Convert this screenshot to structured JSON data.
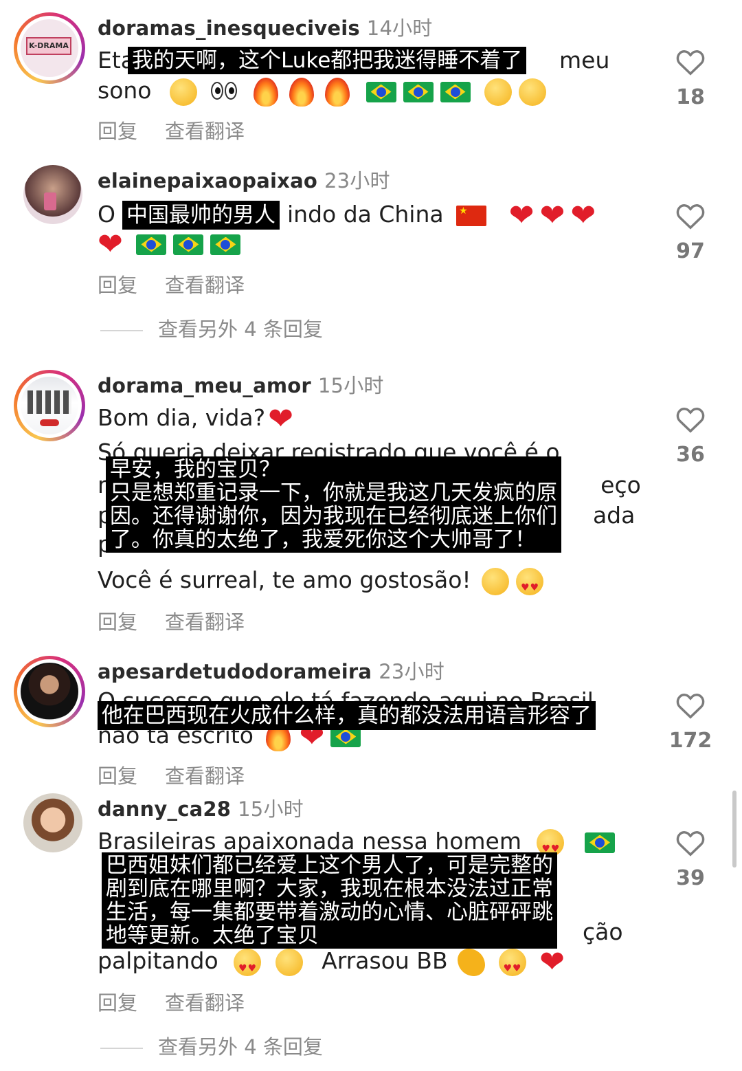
{
  "comments": [
    {
      "username": "doramas_inesqueciveis",
      "time": "14小时",
      "line1_prefix": "Eta",
      "line1_suffix": "meu",
      "line2": "sono",
      "overlay": "我的天啊，这个Luke都把我迷得睡不着了",
      "likes": "18",
      "reply": "回复",
      "translate": "查看翻译",
      "avatar_text": "K-DRAMA"
    },
    {
      "username": "elainepaixaopaixao",
      "time": "23小时",
      "line1_prefix": "O",
      "line1_suffix": "indo da China",
      "overlay": "中国最帅的男人",
      "likes": "97",
      "reply": "回复",
      "translate": "查看翻译",
      "more_replies": "查看另外 4 条回复"
    },
    {
      "username": "dorama_meu_amor",
      "time": "15小时",
      "line1": "Bom dia, vida?",
      "line2_fragment": "Só queria deixar registrado que você é o",
      "line3_left": "m",
      "line3_right": "eço",
      "line4_left": "p",
      "line4_right": "ada",
      "line5_left": "p",
      "overlay_lines": [
        "早安，我的宝贝？",
        "只是想郑重记录一下，你就是我这几天发疯的原",
        "因。还得谢谢你，因为我现在已经彻底迷上你们",
        "了。你真的太绝了，我爱死你这个大帅哥了！"
      ],
      "line_last": "Você é surreal, te amo gostosão!",
      "likes": "36",
      "reply": "回复",
      "translate": "查看翻译"
    },
    {
      "username": "apesardetudodorameira",
      "time": "23小时",
      "line1_fragment": "O sucesso que ele tá fazendo aqui no Brasil",
      "line2": "não tá escrito",
      "overlay": "他在巴西现在火成什么样，真的都没法用语言形容了",
      "likes": "172",
      "reply": "回复",
      "translate": "查看翻译"
    },
    {
      "username": "danny_ca28",
      "time": "15小时",
      "line1": "Brasileiras apaixonada nessa homem",
      "line_tail": "ção",
      "line_last_text": "palpitando",
      "line_last_mid": "Arrasou BB",
      "overlay_lines": [
        "巴西姐妹们都已经爱上这个男人了，可是完整的",
        "剧到底在哪里啊？大家，我现在根本没法过正常",
        "生活，每一集都要带着激动的心情、心脏砰砰跳",
        "地等更新。太绝了宝贝"
      ],
      "likes": "39",
      "reply": "回复",
      "translate": "查看翻译",
      "more_replies": "查看另外 4 条回复"
    }
  ],
  "colors": {
    "text": "#1f1f1f",
    "muted": "#8a8a8a",
    "overlay_bg": "#000000",
    "overlay_text": "#ffffff",
    "heart_red": "#e11d2a"
  }
}
